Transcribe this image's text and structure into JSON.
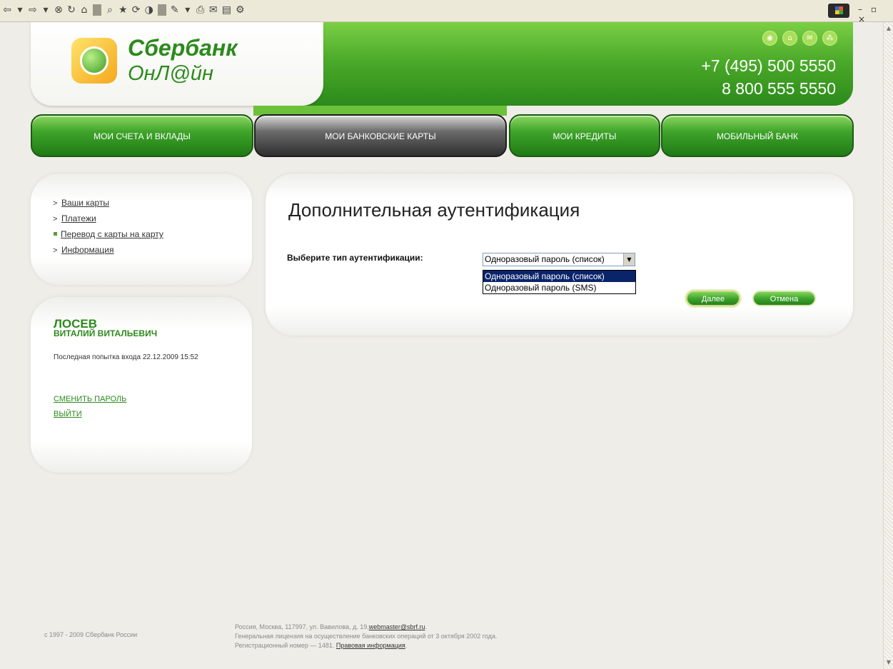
{
  "browser": {
    "toolbar_icons": [
      "⇦",
      "▾",
      "⇨",
      "▾",
      "⊗",
      "↻",
      "⌂",
      "⌕",
      "★",
      "⟳",
      "◑",
      "✎",
      "▾",
      "⎙",
      "✉",
      "▤",
      "⚙"
    ],
    "window_controls": "– ▫ ×"
  },
  "header": {
    "logo_title": "Сбербанк",
    "logo_subtitle": "ОнЛ@йн",
    "phone_1": "+7 (495) 500 5550",
    "phone_2": "8 800 555 5550",
    "icons": [
      "bank-icon",
      "home-icon",
      "mail-icon",
      "sitemap-icon"
    ],
    "icon_glyphs": [
      "◉",
      "⌂",
      "✉",
      "⁂"
    ]
  },
  "nav": {
    "items": [
      {
        "label": "МОИ СЧЕТА И ВКЛАДЫ"
      },
      {
        "label": "МОИ БАНКОВСКИЕ КАРТЫ",
        "active": true
      },
      {
        "label": "МОИ КРЕДИТЫ"
      },
      {
        "label": "МОБИЛЬНЫЙ БАНК"
      }
    ]
  },
  "sidebar": {
    "menu": [
      {
        "label": "Ваши карты",
        "marker": ">"
      },
      {
        "label": "Платежи",
        "marker": ">"
      },
      {
        "label": "Перевод с карты на карту",
        "marker": "■"
      },
      {
        "label": "Информация",
        "marker": ">"
      }
    ]
  },
  "user": {
    "last_name": "ЛОСЕВ",
    "first_middle": "ВИТАЛИЙ ВИТАЛЬЕВИЧ",
    "last_login": "Последная попытка входа 22.12.2009 15:52",
    "change_password": "СМЕНИТЬ ПАРОЛЬ",
    "logout": "ВЫЙТИ"
  },
  "main": {
    "title": "Дополнительная аутентификация",
    "auth_label": "Выберите тип аутентификации:",
    "auth_selected": "Одноразовый пароль (список)",
    "auth_options": [
      "Одноразовый пароль (список)",
      "Одноразовый пароль (SMS)"
    ],
    "next_button": "Далее",
    "cancel_button": "Отмена"
  },
  "footer": {
    "copyright": "с 1997 - 2009 Сбербанк России",
    "address": "Россия, Москва, 117997, ул. Вавилова, д. 19,",
    "email": "webmaster@sbrf.ru",
    "license": "Генеральная лицензия на осуществление банковских операций от 3 октября 2002 года.",
    "reg_number": "Регистрационный номер — 1481.",
    "legal_link": "Правовая информация"
  },
  "colors": {
    "brand_green": "#2c8a1c",
    "nav_green": "#3fa42a",
    "nav_active": "#4a4a4a",
    "selection": "#0a246a"
  }
}
